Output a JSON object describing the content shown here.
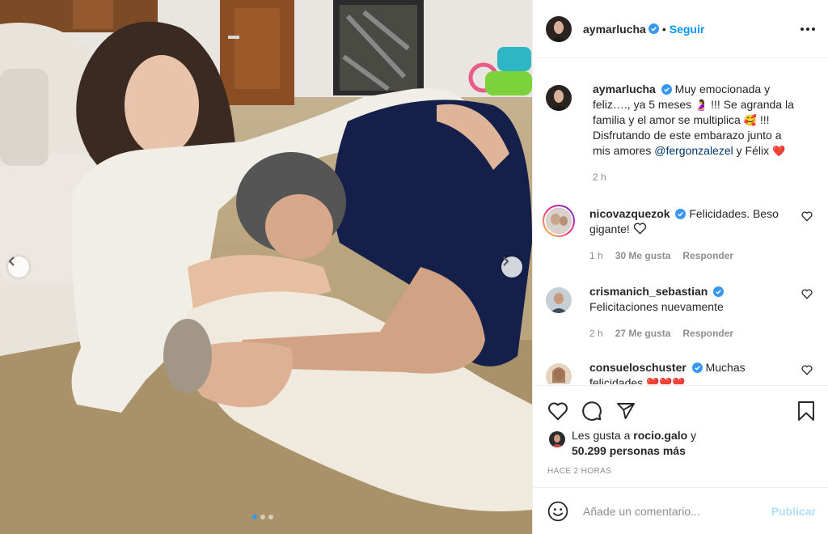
{
  "post": {
    "username": "aymarlucha",
    "follow_label": "Seguir",
    "separator": "•"
  },
  "caption": {
    "username": "aymarlucha",
    "text_1": "Muy emocionada y feliz…., ya 5 meses",
    "emoji_1": "🤰",
    "text_2": "!!! Se agranda la familia y el amor se multiplica",
    "emoji_2": "🥰",
    "text_3": "!!! Disfrutando de este embarazo junto a mis amores",
    "mention": "@fergonzalezel",
    "text_4": "y Félix",
    "emoji_3": "❤️",
    "time": "2 h"
  },
  "comments": [
    {
      "username": "nicovazquezok",
      "text": "Felicidades. Beso gigante!",
      "time": "1 h",
      "likes": "30 Me gusta",
      "reply": "Responder"
    },
    {
      "username": "crismanich_sebastian",
      "text": "Felicitaciones nuevamente",
      "time": "2 h",
      "likes": "27 Me gusta",
      "reply": "Responder"
    },
    {
      "username": "consueloschuster",
      "text": "Muchas felicidades",
      "emoji": "❤️❤️❤️"
    }
  ],
  "likes": {
    "prefix": "Les gusta a",
    "user": "rocio.galo",
    "conj": "y",
    "count": "50.299 personas más"
  },
  "timestamp": "HACE 2 HORAS",
  "add_comment": {
    "placeholder": "Añade un comentario...",
    "publish_label": "Publicar"
  },
  "carousel": {
    "count": 3,
    "active_index": 0
  },
  "colors": {
    "accent": "#0095f6",
    "verified": "#3897f0",
    "publish_disabled": "#b2dffc"
  },
  "icons": [
    "verified-icon",
    "more-options-icon",
    "heart-icon",
    "comment-icon",
    "share-icon",
    "bookmark-icon",
    "emoji-icon",
    "chevron-left-icon",
    "chevron-right-icon"
  ]
}
